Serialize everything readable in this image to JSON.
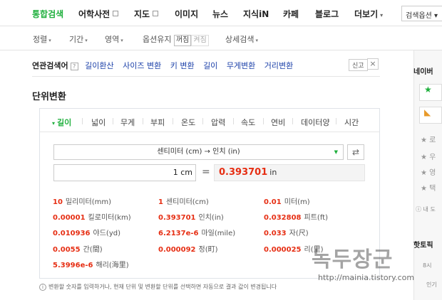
{
  "topnav": {
    "tabs": [
      {
        "label": "통합검색",
        "active": true
      },
      {
        "label": "어학사전",
        "ext": true
      },
      {
        "label": "지도",
        "ext": true
      },
      {
        "label": "이미지"
      },
      {
        "label": "뉴스"
      },
      {
        "label": "지식iN"
      },
      {
        "label": "카페"
      },
      {
        "label": "블로그"
      },
      {
        "label": "더보기"
      }
    ],
    "search_option": "검색옵션 ▾"
  },
  "filters": {
    "sort": "정렬",
    "period": "기간",
    "area": "영역",
    "keep_option": "옵션유지",
    "keep_off": "꺼짐",
    "keep_on": "켜짐",
    "detail": "상세검색"
  },
  "related": {
    "title": "연관검색어",
    "help": "?",
    "keywords": [
      "길이환산",
      "사이즈 변환",
      "키 변환",
      "길이",
      "무게변환",
      "거리변환"
    ],
    "report": "신고",
    "close": "×"
  },
  "converter": {
    "title": "단위변환",
    "categories": [
      "길이",
      "넓이",
      "무게",
      "부피",
      "온도",
      "압력",
      "속도",
      "연비",
      "데이터양",
      "시간"
    ],
    "selected_conversion": "센티미터 (cm)  →  인치 (in)",
    "swap_icon": "⇄",
    "input_value": "1",
    "input_unit": "cm",
    "equals": "=",
    "output_value": "0.393701",
    "output_unit": "in",
    "results": [
      {
        "value": "10",
        "unit": "밀리미터(mm)"
      },
      {
        "value": "1",
        "unit": "센티미터(cm)"
      },
      {
        "value": "0.01",
        "unit": "미터(m)"
      },
      {
        "value": "0.00001",
        "unit": "킬로미터(km)"
      },
      {
        "value": "0.393701",
        "unit": "인치(in)"
      },
      {
        "value": "0.032808",
        "unit": "피트(ft)"
      },
      {
        "value": "0.010936",
        "unit": "야드(yd)"
      },
      {
        "value": "6.2137e-6",
        "unit": "마일(mile)"
      },
      {
        "value": "0.033",
        "unit": "자(尺)"
      },
      {
        "value": "0.0055",
        "unit": "간(間)"
      },
      {
        "value": "0.000092",
        "unit": "정(町)"
      },
      {
        "value": "0.000025",
        "unit": "리(里)"
      },
      {
        "value": "5.3996e-6",
        "unit": "해리(海里)"
      }
    ],
    "footnote": "변환할 숫자를 입력하거나, 현재 단위 및 변환할 단위를 선택하면 자동으로 결과 값이 변경됩니다"
  },
  "right_panel": {
    "title": "네이버 ",
    "rows": [
      "로",
      "우",
      "영",
      "택"
    ],
    "sub": "ⓘ 내 도",
    "hot_title": "핫토픽",
    "hot_sub": "8시",
    "bottom": "인기"
  },
  "watermark": {
    "text": "녹두장군",
    "url": "http://mainia.tistory.com"
  }
}
